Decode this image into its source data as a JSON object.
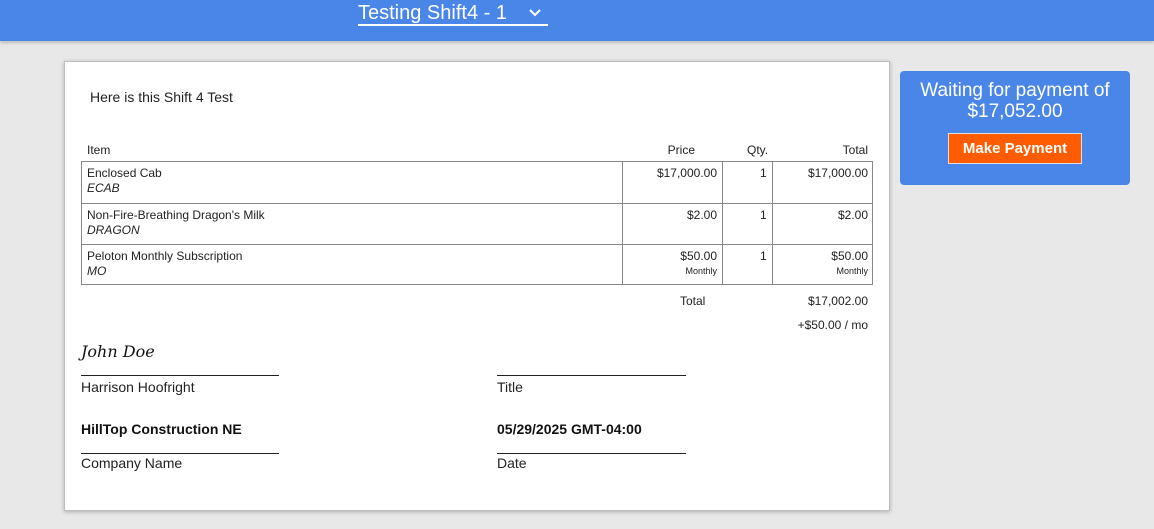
{
  "header": {
    "document_select": {
      "value": "Testing Shift4 - 1",
      "icon": "chevron-down-icon"
    }
  },
  "quote": {
    "intro": "Here is this Shift 4 Test",
    "columns": {
      "item": "Item",
      "price": "Price",
      "qty": "Qty.",
      "total": "Total"
    },
    "items": [
      {
        "name": "Enclosed Cab",
        "code": "ECAB",
        "price": "$17,000.00",
        "qty": "1",
        "total": "$17,000.00"
      },
      {
        "name": "Non-Fire-Breathing Dragon's Milk",
        "code": "DRAGON",
        "price": "$2.00",
        "qty": "1",
        "total": "$2.00"
      },
      {
        "name": "Peloton Monthly Subscription",
        "code": "MO",
        "price": "$50.00",
        "price_note": "Monthly",
        "qty": "1",
        "total": "$50.00",
        "total_note": "Monthly"
      }
    ],
    "summary": {
      "label": "Total",
      "value": "$17,002.00",
      "recurring": "+$50.00 / mo"
    }
  },
  "signature": {
    "signature_text": "John Doe",
    "signer_name": "Harrison Hoofright",
    "title_label": "Title",
    "company": "HillTop Construction NE",
    "company_label": "Company Name",
    "date": "05/29/2025 GMT-04:00",
    "date_label": "Date"
  },
  "payment": {
    "message": "Waiting for payment of $17,052.00",
    "button_label": "Make Payment"
  },
  "colors": {
    "topbar": "#4a86e8",
    "panel": "#4a86e8",
    "button": "#ff5c00"
  }
}
